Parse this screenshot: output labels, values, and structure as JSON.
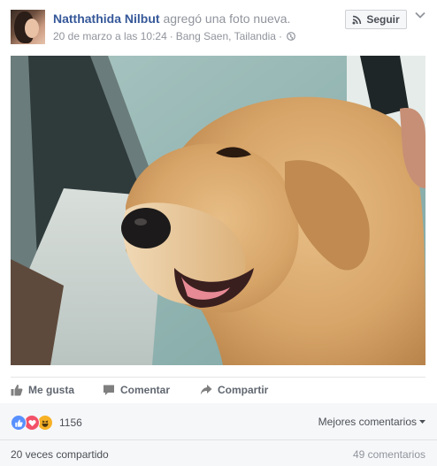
{
  "post": {
    "author_name": "Natthathida Nilbut",
    "action_text": "agregó una foto nueva.",
    "date": "20 de marzo a las 10:24",
    "location": "Bang Saen, Tailandia",
    "privacy_icon": "globe-icon"
  },
  "header": {
    "follow_label": "Seguir",
    "follow_icon": "rss-icon",
    "menu_icon": "chevron-down-icon"
  },
  "photo": {
    "subject": "golden-retriever-photo"
  },
  "actions": {
    "like": "Me gusta",
    "comment": "Comentar",
    "share": "Compartir"
  },
  "reactions": {
    "types": [
      "like",
      "love",
      "haha"
    ],
    "count": "1156",
    "sort_label": "Mejores comentarios"
  },
  "stats": {
    "shares": "20 veces compartido",
    "comments": "49 comentarios"
  },
  "colors": {
    "link": "#365899",
    "secondary_text": "#90949c",
    "action_text": "#616770",
    "like_blue": "#5890ff",
    "love_red": "#f25268",
    "haha_yellow": "#f7b125",
    "footer_bg": "#f6f7f9"
  }
}
